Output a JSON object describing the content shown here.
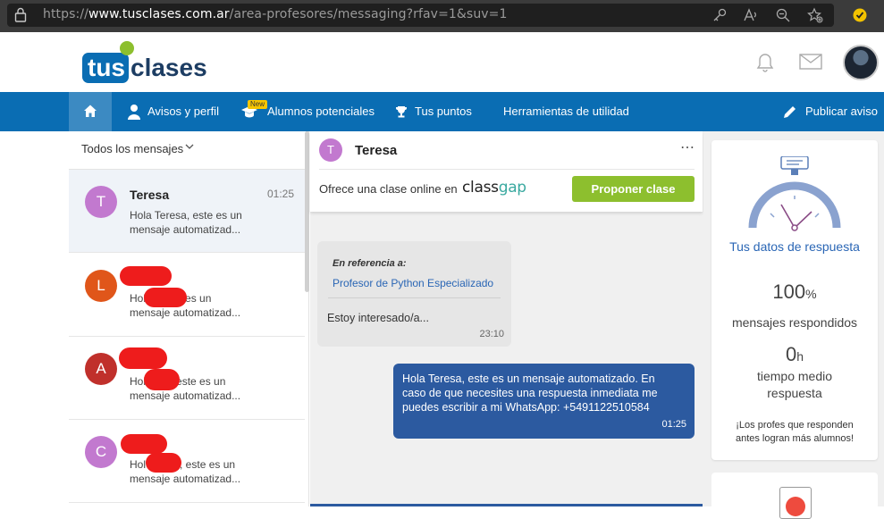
{
  "browser": {
    "url_prefix": "https://",
    "url_domain": "www.tusclases.com.ar",
    "url_path": "/area-profesores/messaging?rfav=1&suv=1"
  },
  "header": {
    "logo_part1": "tus",
    "logo_part2": "clases"
  },
  "nav": {
    "items": [
      "Avisos y perfil",
      "Alumnos potenciales",
      "Tus puntos",
      "Herramientas de utilidad"
    ],
    "new_badge": "New",
    "publish": "Publicar aviso"
  },
  "inbox": {
    "filter_label": "Todos los mensajes",
    "conversations": [
      {
        "initial": "T",
        "name": "Teresa",
        "time": "01:25",
        "preview": "Hola Teresa, este es un mensaje automatizad...",
        "color": "#c279cf"
      },
      {
        "initial": "L",
        "preview_start": "Hol",
        "preview_rest": "este es un",
        "preview_line2": "mensaje automatizad...",
        "color": "#e0561a"
      },
      {
        "initial": "A",
        "preview_start": "Hol",
        "preview_rest": "este es un",
        "preview_line2": "mensaje automatizad...",
        "color": "#c0302b"
      },
      {
        "initial": "C",
        "preview_start": "Hol",
        "preview_rest": ", este es un",
        "preview_line2": "mensaje automatizad...",
        "color": "#c279cf"
      }
    ]
  },
  "chat": {
    "contact_initial": "T",
    "contact_name": "Teresa",
    "more": "⋯",
    "offer_text": "Ofrece una clase online en",
    "brand_part1": "class",
    "brand_part2": "gap",
    "propose_button": "Proponer clase",
    "incoming": {
      "ref_label": "En referencia a:",
      "ref_link": "Profesor de Python Especializado",
      "text": "Estoy interesado/a...",
      "time": "23:10"
    },
    "outgoing": {
      "text": "Hola Teresa, este es un mensaje automatizado. En caso de que necesites una respuesta inmediata me puedes escribir a mi WhatsApp: +5491122510584",
      "time": "01:25"
    }
  },
  "stats": {
    "title": "Tus datos de respuesta",
    "responded_value": "100",
    "responded_unit": "%",
    "responded_label": "mensajes respondidos",
    "time_value": "0",
    "time_unit": "h",
    "time_label": "tiempo medio respuesta",
    "note": "¡Los profes que responden antes logran más alumnos!"
  },
  "colors": {
    "nav_blue": "#0a6db3",
    "accent_green": "#8dbf2e",
    "bubble_blue": "#2c5aa0",
    "link_blue": "#2a66b5",
    "redaction_red": "#ee1c1c"
  }
}
